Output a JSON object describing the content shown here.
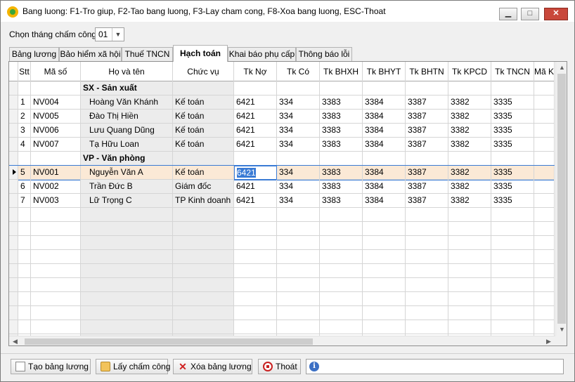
{
  "window": {
    "title": "Bang luong: F1-Tro giup, F2-Tao bang luong, F3-Lay cham cong, F8-Xoa bang luong, ESC-Thoat",
    "min_glyph": "▁",
    "max_glyph": "□",
    "close_glyph": "✕"
  },
  "month": {
    "label": "Chọn tháng chấm công:",
    "value": "01",
    "chevron": "▼"
  },
  "tabs": [
    {
      "label": "Bảng lương"
    },
    {
      "label": "Bảo hiểm xã hội"
    },
    {
      "label": "Thuế TNCN"
    },
    {
      "label": "Hạch toán",
      "active": true
    },
    {
      "label": "Khai báo phụ cấp"
    },
    {
      "label": "Thông báo lỗi"
    }
  ],
  "columns": [
    "Stt",
    "Mã số",
    "Họ và tên",
    "Chức vụ",
    "Tk Nợ",
    "Tk Có",
    "Tk BHXH",
    "Tk BHYT",
    "Tk BHTN",
    "Tk KPCD",
    "Tk TNCN",
    "Mã K"
  ],
  "rows": [
    {
      "type": "group",
      "name": "SX - Sản xuất"
    },
    {
      "stt": "1",
      "code": "NV004",
      "name": "Hoàng Văn Khánh",
      "position": "Kế toán",
      "tk_no": "6421",
      "tk_co": "334",
      "tk_bhxh": "3383",
      "tk_bhyt": "3384",
      "tk_bhtn": "3387",
      "tk_kpcd": "3382",
      "tk_tncn": "3335"
    },
    {
      "stt": "2",
      "code": "NV005",
      "name": "Đào Thị Hiền",
      "position": "Kế toán",
      "tk_no": "6421",
      "tk_co": "334",
      "tk_bhxh": "3383",
      "tk_bhyt": "3384",
      "tk_bhtn": "3387",
      "tk_kpcd": "3382",
      "tk_tncn": "3335"
    },
    {
      "stt": "3",
      "code": "NV006",
      "name": "Lưu Quang Dũng",
      "position": "Kế toán",
      "tk_no": "6421",
      "tk_co": "334",
      "tk_bhxh": "3383",
      "tk_bhyt": "3384",
      "tk_bhtn": "3387",
      "tk_kpcd": "3382",
      "tk_tncn": "3335"
    },
    {
      "stt": "4",
      "code": "NV007",
      "name": "Tạ Hữu Loan",
      "position": "Kế toán",
      "tk_no": "6421",
      "tk_co": "334",
      "tk_bhxh": "3383",
      "tk_bhyt": "3384",
      "tk_bhtn": "3387",
      "tk_kpcd": "3382",
      "tk_tncn": "3335"
    },
    {
      "type": "group",
      "name": "VP - Văn phòng"
    },
    {
      "stt": "5",
      "code": "NV001",
      "name": "Nguyễn Văn A",
      "position": "Kế toán",
      "tk_no": "6421",
      "tk_co": "334",
      "tk_bhxh": "3383",
      "tk_bhyt": "3384",
      "tk_bhtn": "3387",
      "tk_kpcd": "3382",
      "tk_tncn": "3335",
      "selected": true
    },
    {
      "stt": "6",
      "code": "NV002",
      "name": "Trần Đức B",
      "position": "Giám đốc",
      "tk_no": "6421",
      "tk_co": "334",
      "tk_bhxh": "3383",
      "tk_bhyt": "3384",
      "tk_bhtn": "3387",
      "tk_kpcd": "3382",
      "tk_tncn": "3335"
    },
    {
      "stt": "7",
      "code": "NV003",
      "name": "Lữ Trọng C",
      "position": "TP Kinh doanh",
      "tk_no": "6421",
      "tk_co": "334",
      "tk_bhxh": "3383",
      "tk_bhyt": "3384",
      "tk_bhtn": "3387",
      "tk_kpcd": "3382",
      "tk_tncn": "3335"
    }
  ],
  "scroll_glyphs": {
    "up": "▲",
    "down": "▼",
    "left": "◀",
    "right": "▶"
  },
  "buttons": {
    "create": "Tạo bảng lương",
    "fetch": "Lấy chấm công",
    "delete": "Xóa bảng lương",
    "exit": "Thoát",
    "x_glyph": "✕"
  },
  "status": {
    "text": "",
    "info_glyph": "i"
  },
  "icons": [
    "app-icon",
    "minimize-icon",
    "maximize-icon",
    "close-icon",
    "chevron-down-icon",
    "row-pointer-icon",
    "new-document-icon",
    "folder-open-icon",
    "delete-x-icon",
    "stop-icon",
    "info-icon"
  ]
}
